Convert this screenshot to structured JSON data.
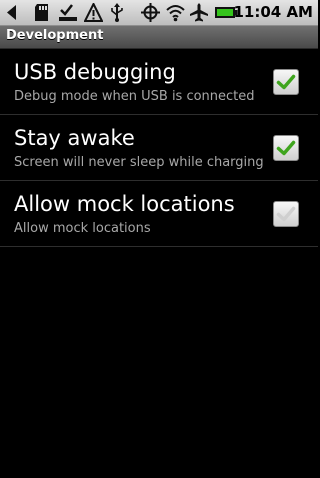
{
  "status_bar": {
    "icons": [
      "back-icon",
      "sd-card-icon",
      "download-complete-icon",
      "warning-icon",
      "usb-icon",
      "gps-icon",
      "wifi-icon",
      "airplane-icon",
      "battery-icon"
    ],
    "time": "11:04 AM"
  },
  "title_bar": {
    "title": "Development"
  },
  "settings": {
    "items": [
      {
        "title": "USB debugging",
        "summary": "Debug mode when USB is connected",
        "checked": true
      },
      {
        "title": "Stay awake",
        "summary": "Screen will never sleep while charging",
        "checked": true
      },
      {
        "title": "Allow mock locations",
        "summary": "Allow mock locations",
        "checked": false
      }
    ]
  },
  "colors": {
    "check_green": "#3fa51e",
    "summary_gray": "#a8a8a8"
  }
}
